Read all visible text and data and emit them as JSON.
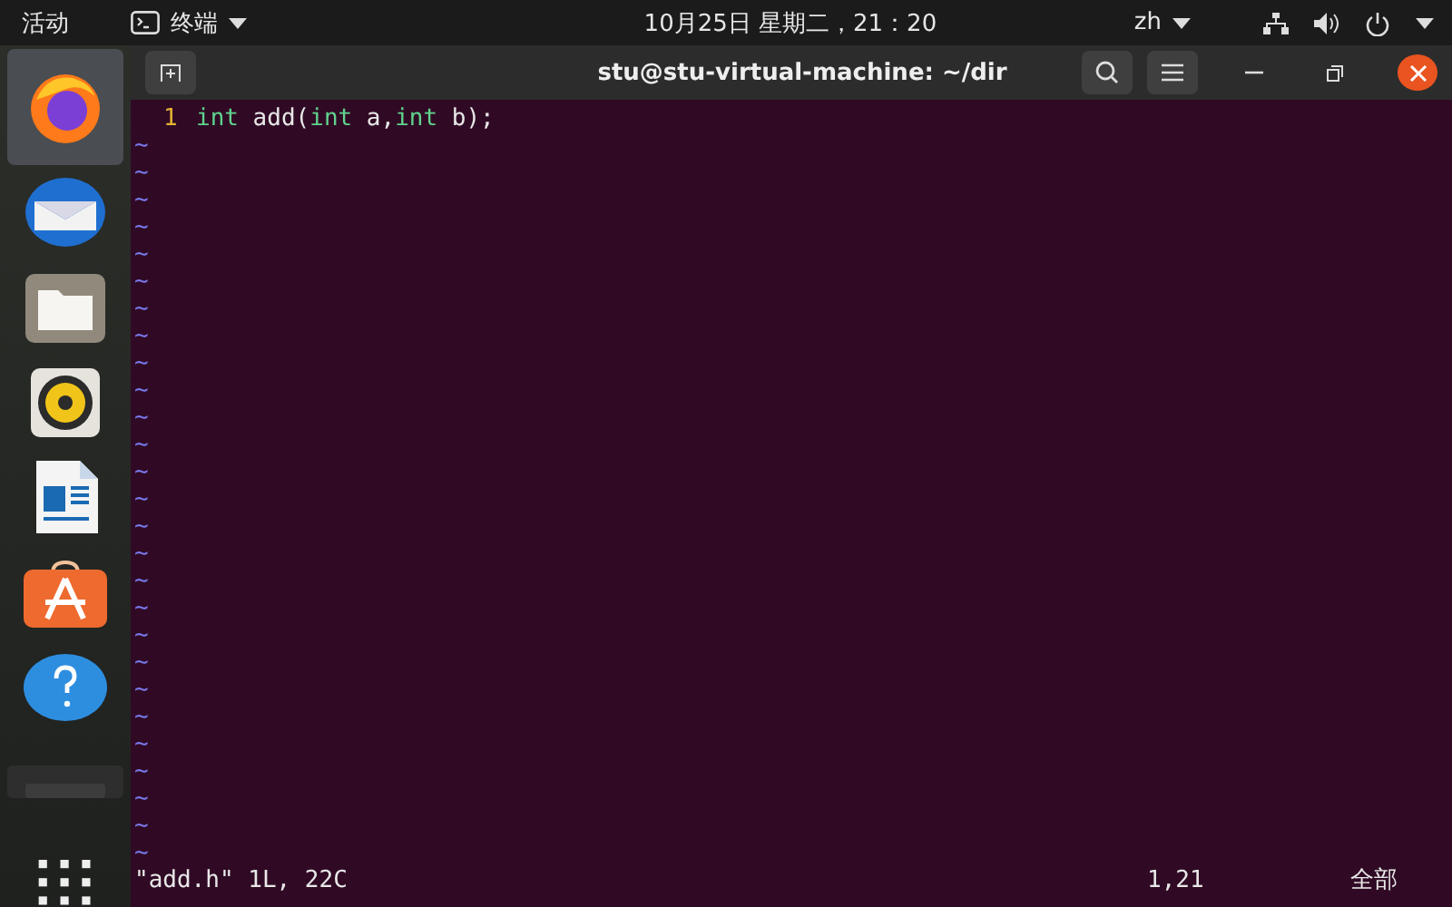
{
  "top_bar": {
    "activities": "活动",
    "app_menu": "终端",
    "clock": "10月25日 星期二，21：20",
    "input_method": "zh"
  },
  "dock": {
    "items": [
      {
        "kind": "firefox",
        "selected": true
      },
      {
        "kind": "mail",
        "selected": false
      },
      {
        "kind": "files",
        "selected": false
      },
      {
        "kind": "speaker",
        "selected": false
      },
      {
        "kind": "writer",
        "selected": false
      },
      {
        "kind": "store",
        "selected": false
      },
      {
        "kind": "help",
        "selected": false
      },
      {
        "kind": "drive",
        "selected": false
      }
    ]
  },
  "window": {
    "title": "stu@stu-virtual-machine: ~/dir"
  },
  "editor": {
    "lines": [
      {
        "number": "1",
        "tokens": [
          {
            "text": "int",
            "kind": "type"
          },
          {
            "text": " add(",
            "kind": "plain"
          },
          {
            "text": "int",
            "kind": "type"
          },
          {
            "text": " a,",
            "kind": "plain"
          },
          {
            "text": "int",
            "kind": "type"
          },
          {
            "text": " b);",
            "kind": "plain"
          }
        ]
      }
    ],
    "tildes": [
      "~",
      "~",
      "~",
      "~",
      "~",
      "~",
      "~",
      "~",
      "~",
      "~",
      "~",
      "~",
      "~",
      "~",
      "~",
      "~",
      "~",
      "~",
      "~",
      "~",
      "~",
      "~",
      "~",
      "~",
      "~",
      "~",
      "~"
    ],
    "status_message": "\"add.h\" 1L, 22C",
    "ruler": "1,21",
    "position": "全部"
  }
}
